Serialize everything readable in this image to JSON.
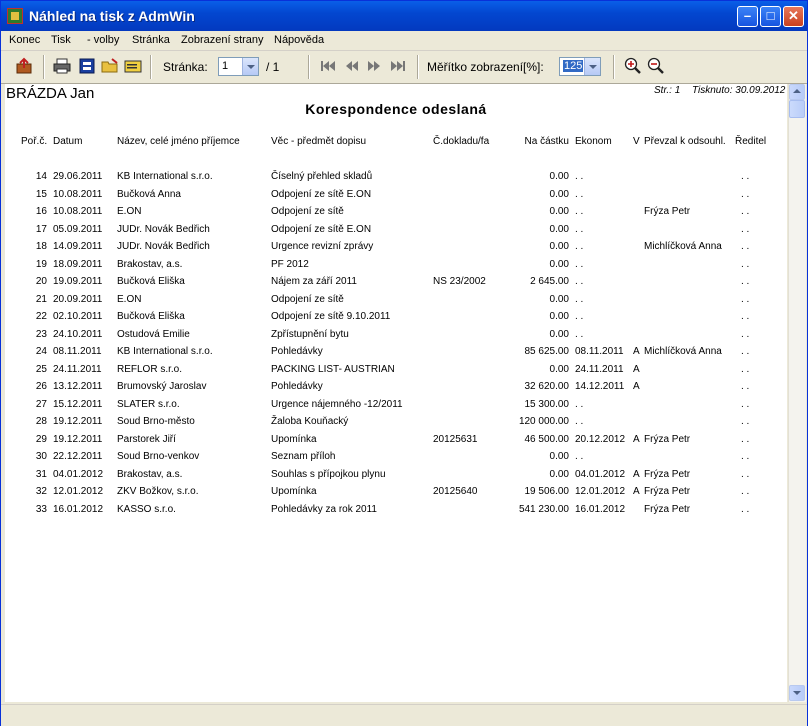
{
  "window": {
    "title": "Náhled na tisk z AdmWin"
  },
  "menu": [
    "Konec",
    "Tisk",
    "- volby",
    "Stránka",
    "Zobrazení strany",
    "Nápověda"
  ],
  "toolbar": {
    "page_label": "Stránka:",
    "page_value": "1",
    "page_total": "/ 1",
    "zoom_label": "Měřítko zobrazení[%]:",
    "zoom_value": "125"
  },
  "report": {
    "person": "BRÁZDA Jan",
    "page_info": "Str.: 1",
    "printed_info": "Tisknuto: 30.09.2012",
    "title": "Korespondence odeslaná",
    "columns": [
      "Poř.č.",
      "Datum",
      "Název, celé jméno příjemce",
      "Věc - předmět dopisu",
      "Č.dokladu/fa",
      "Na částku",
      "Ekonom",
      "V",
      "Převzal k odsouhl.",
      "Ředitel"
    ],
    "rows": [
      [
        "14",
        "29.06.2011",
        "KB International s.r.o.",
        "Číselný přehled skladů",
        "",
        "0.00",
        ". .",
        "",
        "",
        ". ."
      ],
      [
        "15",
        "10.08.2011",
        "Bučková Anna",
        "Odpojení ze sítě E.ON",
        "",
        "0.00",
        ". .",
        "",
        "",
        ". ."
      ],
      [
        "16",
        "10.08.2011",
        "E.ON",
        "Odpojení ze sítě",
        "",
        "0.00",
        ". .",
        "",
        "Frýza Petr",
        ". ."
      ],
      [
        "17",
        "05.09.2011",
        "JUDr. Novák Bedřich",
        "Odpojení ze sítě E.ON",
        "",
        "0.00",
        ". .",
        "",
        "",
        ". ."
      ],
      [
        "18",
        "14.09.2011",
        "JUDr. Novák Bedřich",
        "Urgence revizní zprávy",
        "",
        "0.00",
        ". .",
        "",
        "Michlíčková Anna",
        ". ."
      ],
      [
        "19",
        "18.09.2011",
        "Brakostav, a.s.",
        "PF 2012",
        "",
        "0.00",
        ". .",
        "",
        "",
        ". ."
      ],
      [
        "20",
        "19.09.2011",
        "Bučková Eliška",
        "Nájem za září 2011",
        "NS 23/2002",
        "2 645.00",
        ". .",
        "",
        "",
        ". ."
      ],
      [
        "21",
        "20.09.2011",
        "E.ON",
        "Odpojení ze sítě",
        "",
        "0.00",
        ". .",
        "",
        "",
        ". ."
      ],
      [
        "22",
        "02.10.2011",
        "Bučková Eliška",
        "Odpojení ze sítě 9.10.2011",
        "",
        "0.00",
        ". .",
        "",
        "",
        ". ."
      ],
      [
        "23",
        "24.10.2011",
        "Ostudová Emilie",
        "Zpřístupnění bytu",
        "",
        "0.00",
        ". .",
        "",
        "",
        ". ."
      ],
      [
        "24",
        "08.11.2011",
        "KB International s.r.o.",
        "Pohledávky",
        "",
        "85 625.00",
        "08.11.2011",
        "A",
        "Michlíčková Anna",
        ". ."
      ],
      [
        "25",
        "24.11.2011",
        "REFLOR s.r.o.",
        "PACKING LIST- AUSTRIAN",
        "",
        "0.00",
        "24.11.2011",
        "A",
        "",
        ". ."
      ],
      [
        "26",
        "13.12.2011",
        "Brumovský Jaroslav",
        "Pohledávky",
        "",
        "32 620.00",
        "14.12.2011",
        "A",
        "",
        ". ."
      ],
      [
        "27",
        "15.12.2011",
        "SLATER s.r.o.",
        "Urgence nájemného -12/2011",
        "",
        "15 300.00",
        ". .",
        "",
        "",
        ". ."
      ],
      [
        "28",
        "19.12.2011",
        "Soud Brno-město",
        "Žaloba Kouňacký",
        "",
        "120 000.00",
        ". .",
        "",
        "",
        ". ."
      ],
      [
        "29",
        "19.12.2011",
        "Parstorek Jiří",
        "Upomínka",
        "20125631",
        "46 500.00",
        "20.12.2012",
        "A",
        "Frýza Petr",
        ". ."
      ],
      [
        "30",
        "22.12.2011",
        "Soud Brno-venkov",
        "Seznam příloh",
        "",
        "0.00",
        ". .",
        "",
        "",
        ". ."
      ],
      [
        "31",
        "04.01.2012",
        "Brakostav, a.s.",
        "Souhlas s přípojkou plynu",
        "",
        "0.00",
        "04.01.2012",
        "A",
        "Frýza Petr",
        ". ."
      ],
      [
        "32",
        "12.01.2012",
        "ZKV Božkov, s.r.o.",
        "Upomínka",
        "20125640",
        "19 506.00",
        "12.01.2012",
        "A",
        "Frýza Petr",
        ". ."
      ],
      [
        "33",
        "16.01.2012",
        "KASSO s.r.o.",
        "Pohledávky za rok 2011",
        "",
        "541 230.00",
        "16.01.2012",
        "",
        "Frýza Petr",
        ". ."
      ]
    ]
  },
  "colors": {
    "titlebar": "#0347d0",
    "face": "#ece9d8",
    "selection": "#316ac5"
  }
}
